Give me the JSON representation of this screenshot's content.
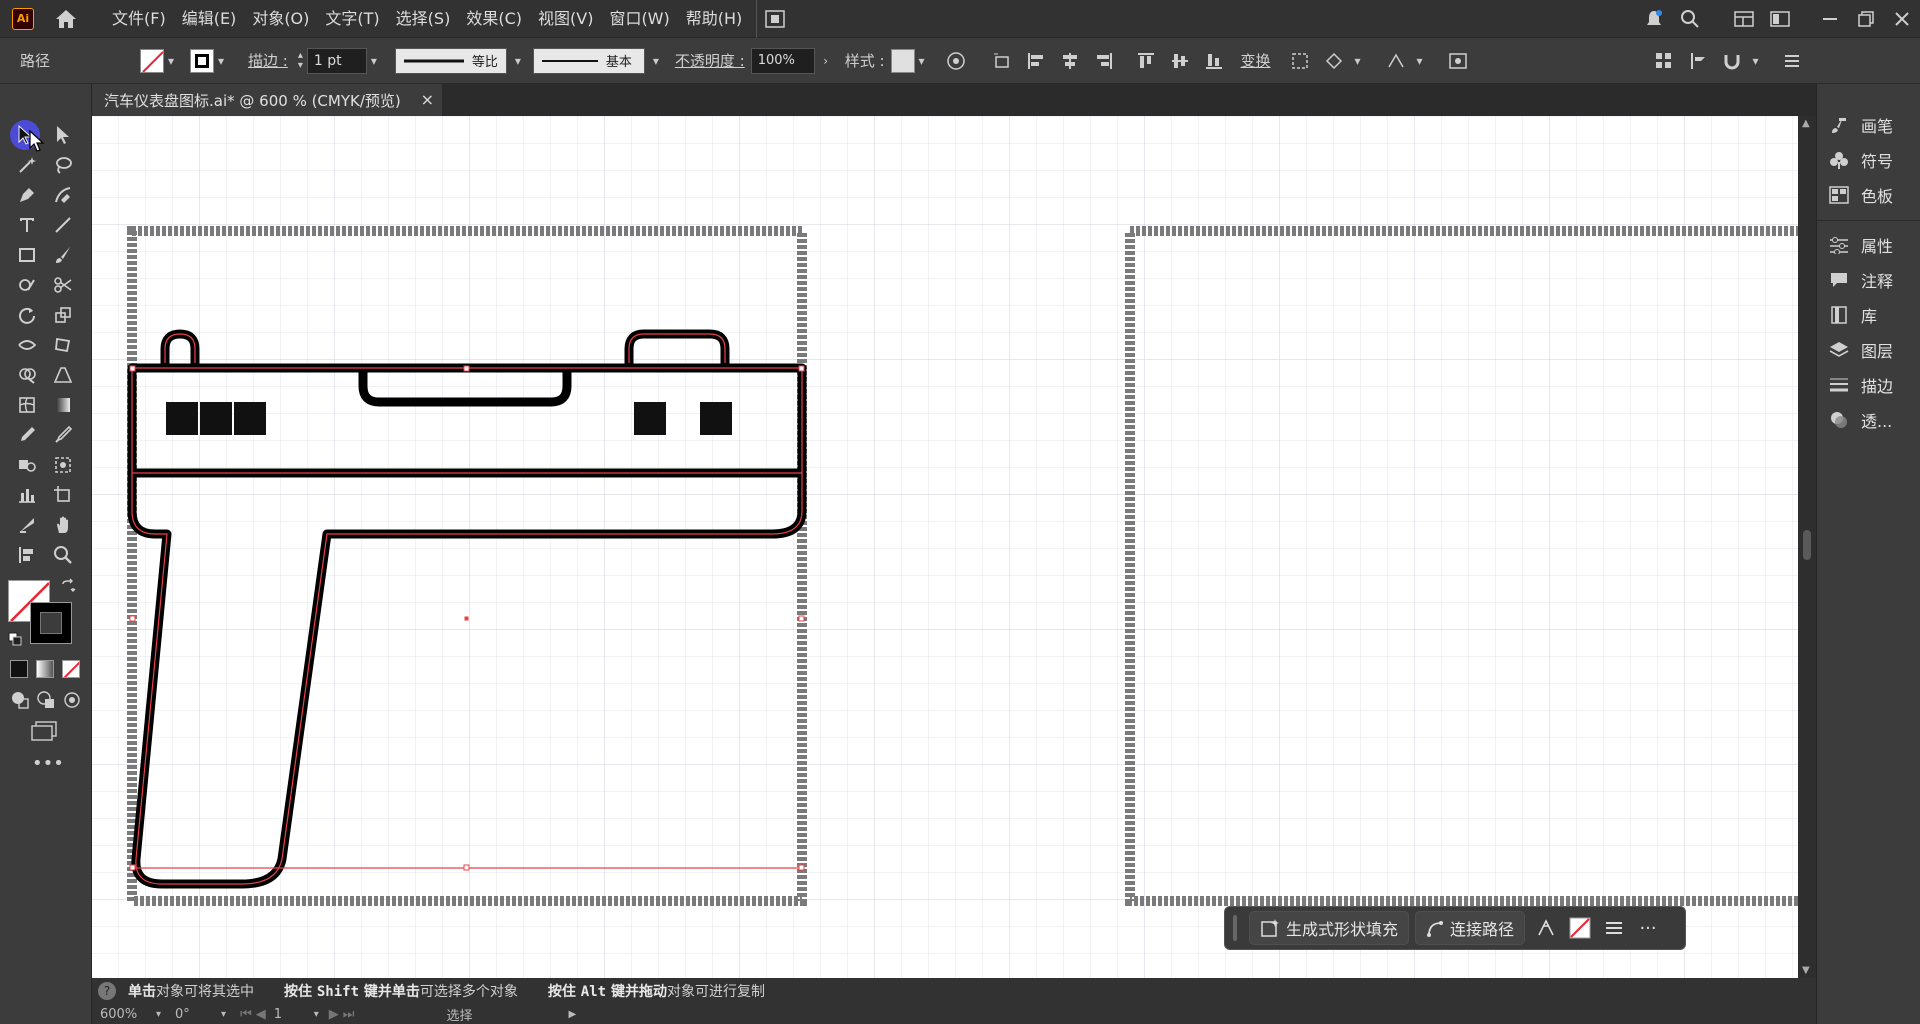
{
  "app": {
    "logo_text": "Ai",
    "menu": [
      "文件(F)",
      "编辑(E)",
      "对象(O)",
      "文字(T)",
      "选择(S)",
      "效果(C)",
      "视图(V)",
      "窗口(W)",
      "帮助(H)"
    ]
  },
  "control": {
    "object_type": "路径",
    "stroke_label": "描边 :",
    "stroke_weight": "1 pt",
    "profile_1": "等比",
    "profile_2": "基本",
    "opacity_label": "不透明度 :",
    "opacity_value": "100%",
    "style_label": "样式 :",
    "transform_label": "变换"
  },
  "document": {
    "tab_title": "汽车仪表盘图标.ai* @ 600 % (CMYK/预览)",
    "close_glyph": "×"
  },
  "right_panel": {
    "items": [
      "画笔",
      "符号",
      "色板",
      "属性",
      "注释",
      "库",
      "图层",
      "描边",
      "透..."
    ]
  },
  "context_bar": {
    "generate_fill": "生成式形状填充",
    "join_path": "连接路径",
    "more": "···"
  },
  "status": {
    "help_icon": "?",
    "tip1_bold": "单击",
    "tip1_rest": "对象可将其选中",
    "tip2_a": "按住 ",
    "tip2_b": "Shift",
    "tip2_c": " 键并单击",
    "tip2_d": "可选择多个对象",
    "tip3_a": "按住 ",
    "tip3_b": "Alt",
    "tip3_c": " 键并拖动",
    "tip3_d": "对象可进行复制"
  },
  "bottom": {
    "zoom": "600%",
    "rotate": "0°",
    "artboard": "1",
    "mode": "选择"
  },
  "colors": {
    "accent": "#4b4bff",
    "selection": "#e8424b",
    "artboard_border": "#7a7a7a"
  }
}
